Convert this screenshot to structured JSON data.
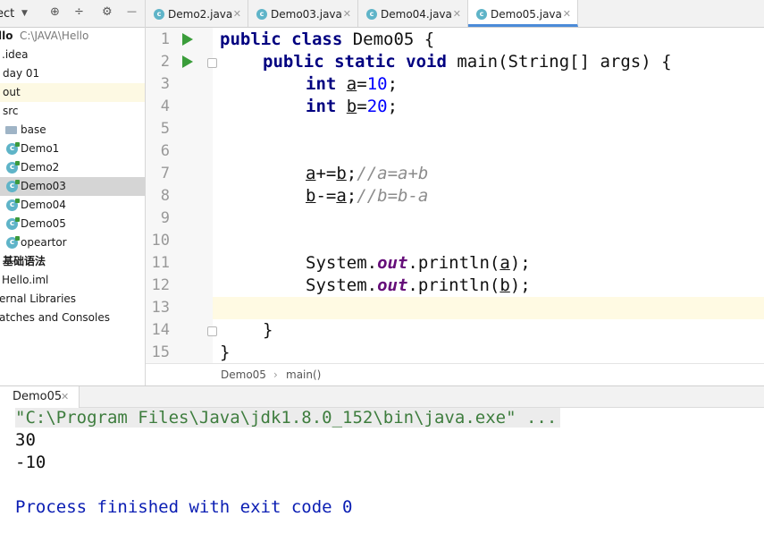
{
  "project_panel": {
    "title": "ect",
    "tree": [
      {
        "label": "llo",
        "sub": "C:\\JAVA\\Hello",
        "bold": true
      },
      {
        "label": ".idea"
      },
      {
        "label": "day 01"
      },
      {
        "label": "out"
      },
      {
        "label": "src"
      },
      {
        "label": "base"
      },
      {
        "label": "Demo1"
      },
      {
        "label": "Demo2"
      },
      {
        "label": "Demo03"
      },
      {
        "label": "Demo04"
      },
      {
        "label": "Demo05"
      },
      {
        "label": "opeartor"
      },
      {
        "label": "基础语法",
        "bold": true
      },
      {
        "label": "Hello.iml"
      },
      {
        "label": "ernal Libraries"
      },
      {
        "label": "atches and Consoles"
      }
    ]
  },
  "tabs": [
    {
      "label": "Demo2.java"
    },
    {
      "label": "Demo03.java"
    },
    {
      "label": "Demo04.java"
    },
    {
      "label": "Demo05.java",
      "active": true
    }
  ],
  "editor": {
    "line_numbers": [
      "1",
      "2",
      "3",
      "4",
      "5",
      "6",
      "7",
      "8",
      "9",
      "10",
      "11",
      "12",
      "13",
      "14",
      "15"
    ],
    "code": {
      "l1_kw": "public class",
      "l1_rest": " Demo05 {",
      "l2_kw": "public static void",
      "l2_rest": " main(String[] args) {",
      "l3_kw": "int",
      "l3_var": "a",
      "l3_eq": "=",
      "l3_num": "10",
      "l3_end": ";",
      "l4_kw": "int",
      "l4_var": "b",
      "l4_eq": "=",
      "l4_num": "20",
      "l4_end": ";",
      "l7_a": "a",
      "l7_op": "+=",
      "l7_b": "b",
      "l7_semi": ";",
      "l7_comment": "//a=a+b",
      "l8_b": "b",
      "l8_op": "-=",
      "l8_a": "a",
      "l8_semi": ";",
      "l8_comment": "//b=b-a",
      "l11_pre": "System.",
      "l11_field": "out",
      "l11_mid": ".println(",
      "l11_arg": "a",
      "l11_end": ");",
      "l12_pre": "System.",
      "l12_field": "out",
      "l12_mid": ".println(",
      "l12_arg": "b",
      "l12_end": ");",
      "l14": "}",
      "l15": "}"
    }
  },
  "breadcrumb": {
    "class": "Demo05",
    "sep": "›",
    "method": "main()"
  },
  "run_panel": {
    "tab_label": "Demo05",
    "output": [
      "\"C:\\Program Files\\Java\\jdk1.8.0_152\\bin\\java.exe\" ...",
      "30",
      "-10",
      "",
      "Process finished with exit code 0"
    ]
  },
  "colors": {
    "keyword": "#000080",
    "number": "#0000ff",
    "comment": "#8c8c8c",
    "field": "#660e7a",
    "run_green": "#3a9d3a",
    "tab_underline": "#4b8bd8",
    "current_line": "#fffae3"
  }
}
